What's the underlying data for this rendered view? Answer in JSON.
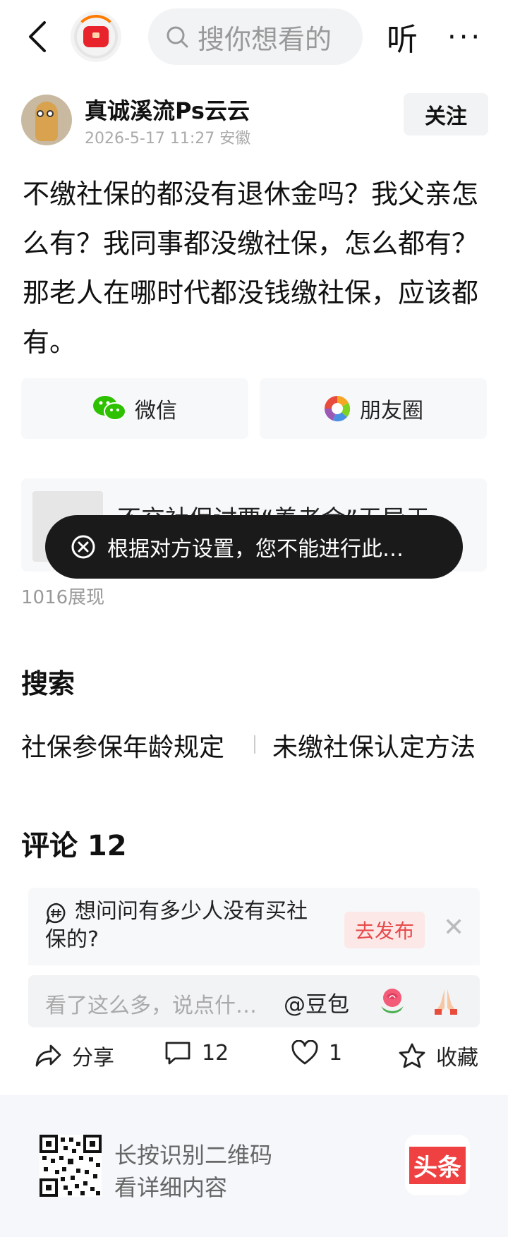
{
  "topbar": {
    "search_placeholder": "搜你想看的",
    "listen_label": "听",
    "more_label": "···"
  },
  "author": {
    "name": "真诚溪流Ps云云",
    "meta": "2026-5-17 11:27 安徽",
    "follow_label": "关注"
  },
  "post": {
    "text": "不缴社保的都没有退休金吗？我父亲怎么有？我同事都没缴社保，怎么都有？那老人在哪时代都没钱缴社保，应该都有。"
  },
  "share": {
    "wechat_label": "微信",
    "moments_label": "朋友圈"
  },
  "related": {
    "title": "不交社保讨要“养老金”无异于…"
  },
  "toast": {
    "text": "根据对方设置，您不能进行此…"
  },
  "views": "1016展现",
  "search_section": {
    "title": "搜索",
    "links": [
      "社保参保年龄规定",
      "未缴社保认定方法"
    ]
  },
  "comments": {
    "title": "评论 12",
    "topic_text": "想问问有多少人没有买社保的?",
    "publish_label": "去发布",
    "input_placeholder": "看了这么多，说点什…",
    "mention_label": "@豆包"
  },
  "actions": {
    "share_label": "分享",
    "comment_count": "12",
    "like_count": "1",
    "favorite_label": "收藏"
  },
  "footer": {
    "line1": "长按识别二维码",
    "line2": "看详细内容",
    "brand": "头条"
  },
  "colors": {
    "accent_red": "#f04142",
    "publish_bg": "#fde8e8",
    "toast_bg": "#1a1a1a"
  }
}
